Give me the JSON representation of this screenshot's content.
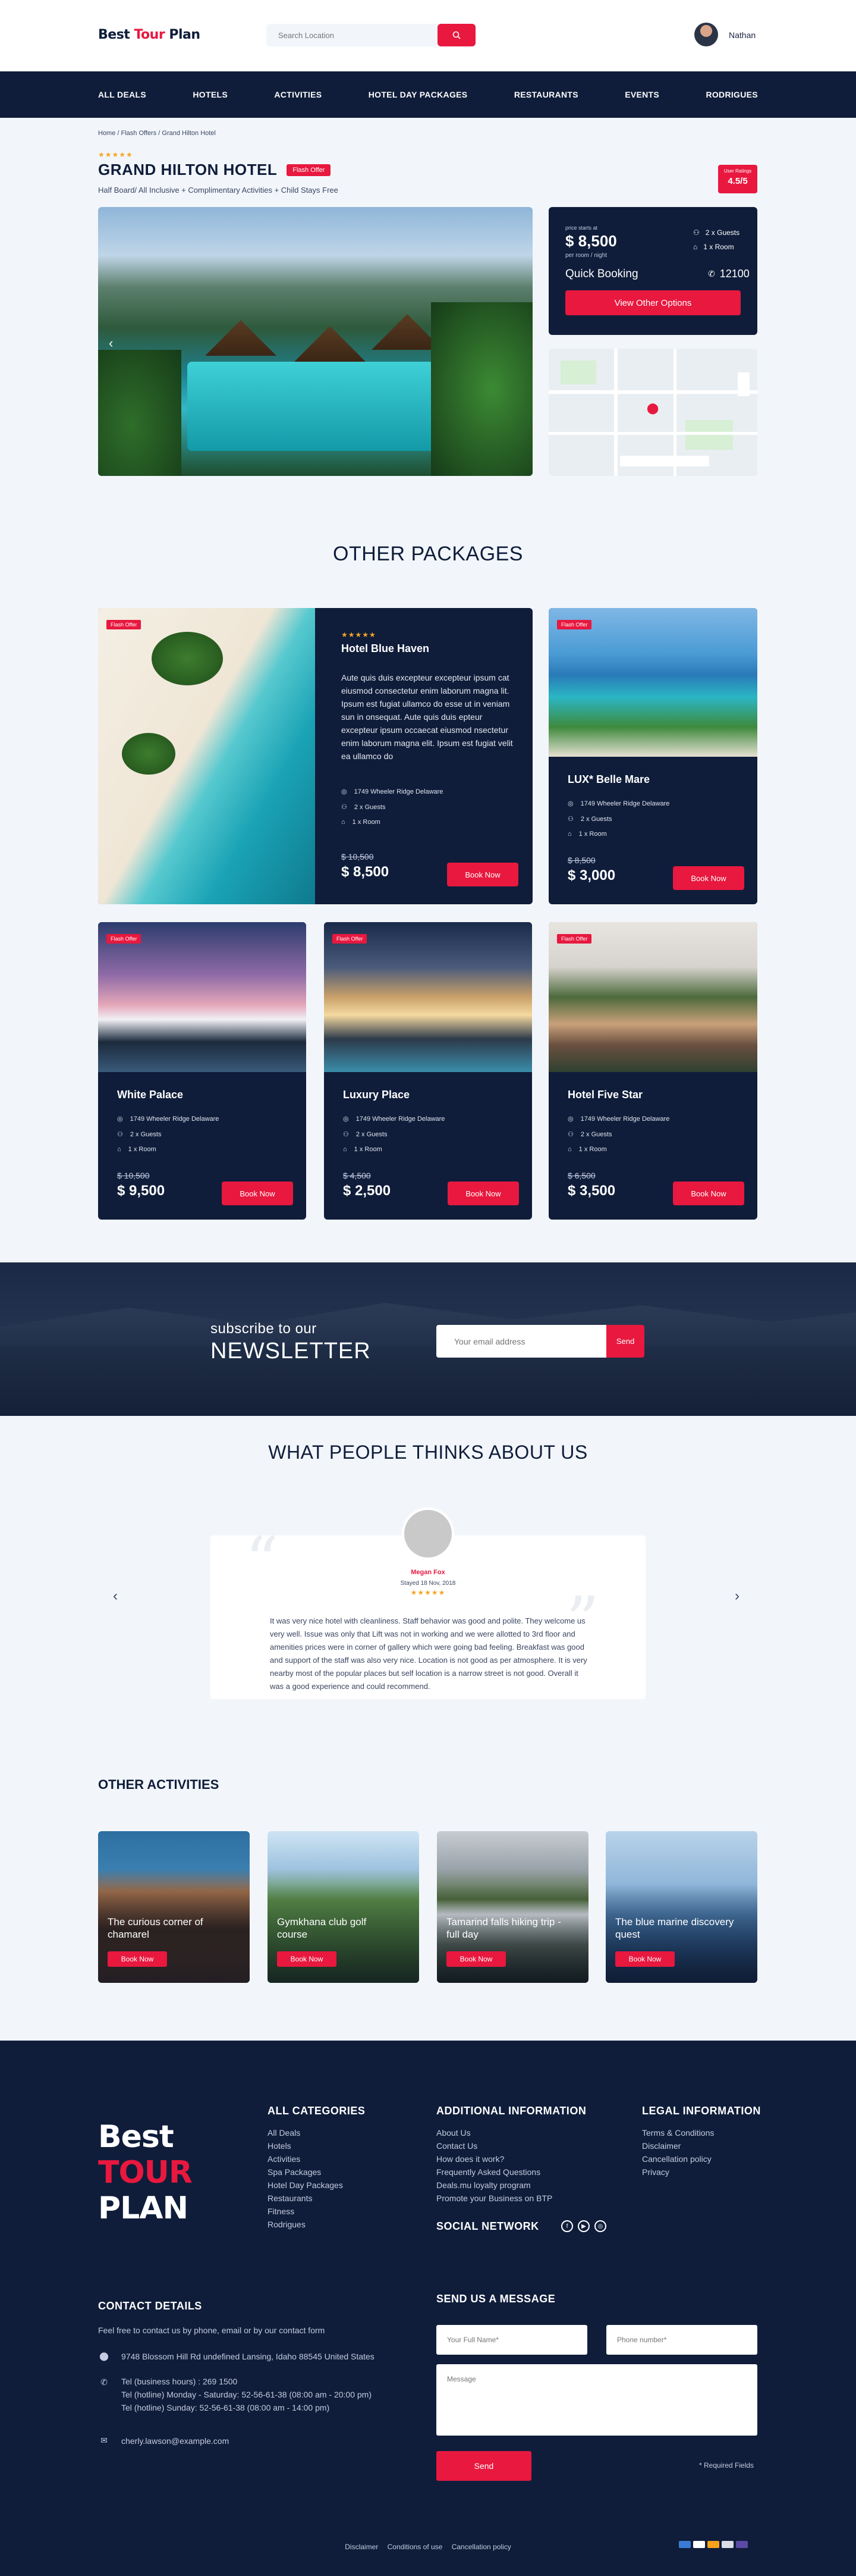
{
  "brand": {
    "logo_part1": "Best ",
    "logo_part2": "Tour",
    "logo_part3": " Plan",
    "colors": {
      "accent": "#e8183f",
      "navy": "#0f1d3a",
      "star": "#f5a623"
    }
  },
  "header": {
    "search_placeholder": "Search Location",
    "search_icon": "search-icon",
    "user_name": "Nathan"
  },
  "nav": {
    "items": [
      "ALL DEALS",
      "HOTELS",
      "ACTIVITIES",
      "HOTEL DAY PACKAGES",
      "RESTAURANTS",
      "EVENTS",
      "RODRIGUES"
    ]
  },
  "hotel": {
    "breadcrumb": "Home / Flash Offers / Grand Hilton Hotel",
    "stars": "★★★★★",
    "name": "GRAND HILTON HOTEL",
    "flash_label": "Flash Offer",
    "subtitle": "Half Board/ All Inclusive + Complimentary Activities + Child Stays Free",
    "rating_label": "User Ratings",
    "rating_value": "4.5/5"
  },
  "booking": {
    "price_label": "price starts at",
    "price": "$ 8,500",
    "per": "per room / night",
    "guests": "2 x Guests",
    "rooms": "1 x Room",
    "quick_label": "Quick Booking",
    "quick_value": "12100",
    "button": "View Other Options"
  },
  "packages": {
    "title": "OTHER PACKAGES",
    "featured": {
      "flash": "Flash Offer",
      "stars": "★★★★★",
      "name": "Hotel Blue Haven",
      "description": "Aute quis duis excepteur excepteur ipsum cat eiusmod consectetur enim laborum magna lit. Ipsum est fugiat ullamco do esse ut in veniam sun in onsequat. Aute quis duis epteur excepteur ipsum occaecat eiusmod nsectetur enim laborum magna elit. Ipsum est fugiat velit ea ullamco do",
      "address": "1749 Wheeler Ridge Delaware",
      "guests": "2 x Guests",
      "room": "1 x Room",
      "old_price": "$ 10,500",
      "price": "$ 8,500",
      "button": "Book Now"
    },
    "cards": [
      {
        "flash": "Flash Offer",
        "name": "LUX* Belle Mare",
        "address": "1749 Wheeler Ridge  Delaware",
        "guests": "2 x Guests",
        "room": "1 x Room",
        "old_price": "$ 8,500",
        "price": "$ 3,000",
        "button": "Book Now"
      },
      {
        "flash": "Flash Offer",
        "name": "White Palace",
        "address": "1749 Wheeler Ridge  Delaware",
        "guests": "2 x Guests",
        "room": "1 x Room",
        "old_price": "$ 10,500",
        "price": "$ 9,500",
        "button": "Book Now"
      },
      {
        "flash": "Flash Offer",
        "name": "Luxury Place",
        "address": "1749 Wheeler Ridge  Delaware",
        "guests": "2 x Guests",
        "room": "1 x Room",
        "old_price": "$ 4,500",
        "price": "$ 2,500",
        "button": "Book Now"
      },
      {
        "flash": "Flash Offer",
        "name": "Hotel Five Star",
        "address": "1749 Wheeler Ridge  Delaware",
        "guests": "2 x Guests",
        "room": "1 x Room",
        "old_price": "$ 6,500",
        "price": "$ 3,500",
        "button": "Book Now"
      }
    ]
  },
  "newsletter": {
    "line1": "subscribe to our",
    "line2": "NEWSLETTER",
    "placeholder": "Your email address",
    "button": "Send"
  },
  "testimonials": {
    "title": "WHAT PEOPLE THINKS ABOUT US",
    "name": "Megan Fox",
    "date": "Stayed 18 Nov, 2018",
    "stars": "★★★★★",
    "text": "It was very nice hotel with cleanliness. Staff behavior was good and polite. They welcome us very well. Issue was only that Lift was not in working and we were allotted to 3rd floor and amenities prices were in corner of gallery which were going bad feeling. Breakfast was good and support of the staff was also very nice. Location is not good as per atmosphere. It is very nearby most of the popular places but self location is a narrow street is not good. Overall it was a good experience and could recommend."
  },
  "activities": {
    "title": "OTHER ACTIVITIES",
    "items": [
      {
        "title": "The curious corner of chamarel",
        "button": "Book Now"
      },
      {
        "title": "Gymkhana club golf course",
        "button": "Book Now"
      },
      {
        "title": "Tamarind falls hiking trip - full day",
        "button": "Book Now"
      },
      {
        "title": "The blue marine discovery quest",
        "button": "Book Now"
      }
    ]
  },
  "footer": {
    "logo": [
      "Best",
      "TOUR",
      "PLAN"
    ],
    "categories_title": "ALL CATEGORIES",
    "categories": [
      "All Deals",
      "Hotels",
      "Activities",
      "Spa Packages",
      "Hotel Day Packages",
      "Restaurants",
      "Fitness",
      "Rodrigues"
    ],
    "additional_title": "ADDITIONAL INFORMATION",
    "additional": [
      "About Us",
      "Contact Us",
      "How does it work?",
      "Frequently Asked Questions",
      "Deals.mu loyalty program",
      "Promote your Business on BTP"
    ],
    "legal_title": "LEGAL INFORMATION",
    "legal": [
      "Terms & Conditions",
      "Disclaimer",
      "Cancellation policy",
      "Privacy"
    ],
    "social_title": "SOCIAL NETWORK",
    "contact_title": "CONTACT DETAILS",
    "contact_intro": "Feel free to contact us by phone, email or by our contact form",
    "address": "9748 Blossom Hill Rd undefined Lansing, Idaho 88545 United States",
    "phones": [
      "Tel (business hours) : 269 1500",
      "Tel (hotline) Monday - Saturday: 52-56-61-38 (08:00 am - 20:00 pm)",
      "Tel (hotline) Sunday: 52-56-61-38 (08:00 am - 14:00 pm)"
    ],
    "email": "cherly.lawson@example.com",
    "message_title": "SEND US A MESSAGE",
    "name_placeholder": "Your Full Name*",
    "phone_placeholder": "Phone number*",
    "message_placeholder": "Message",
    "send": "Send",
    "required": "* Required Fields",
    "bottom_links": [
      "Disclaimer",
      "Conditions of use",
      "Cancellation policy"
    ]
  }
}
